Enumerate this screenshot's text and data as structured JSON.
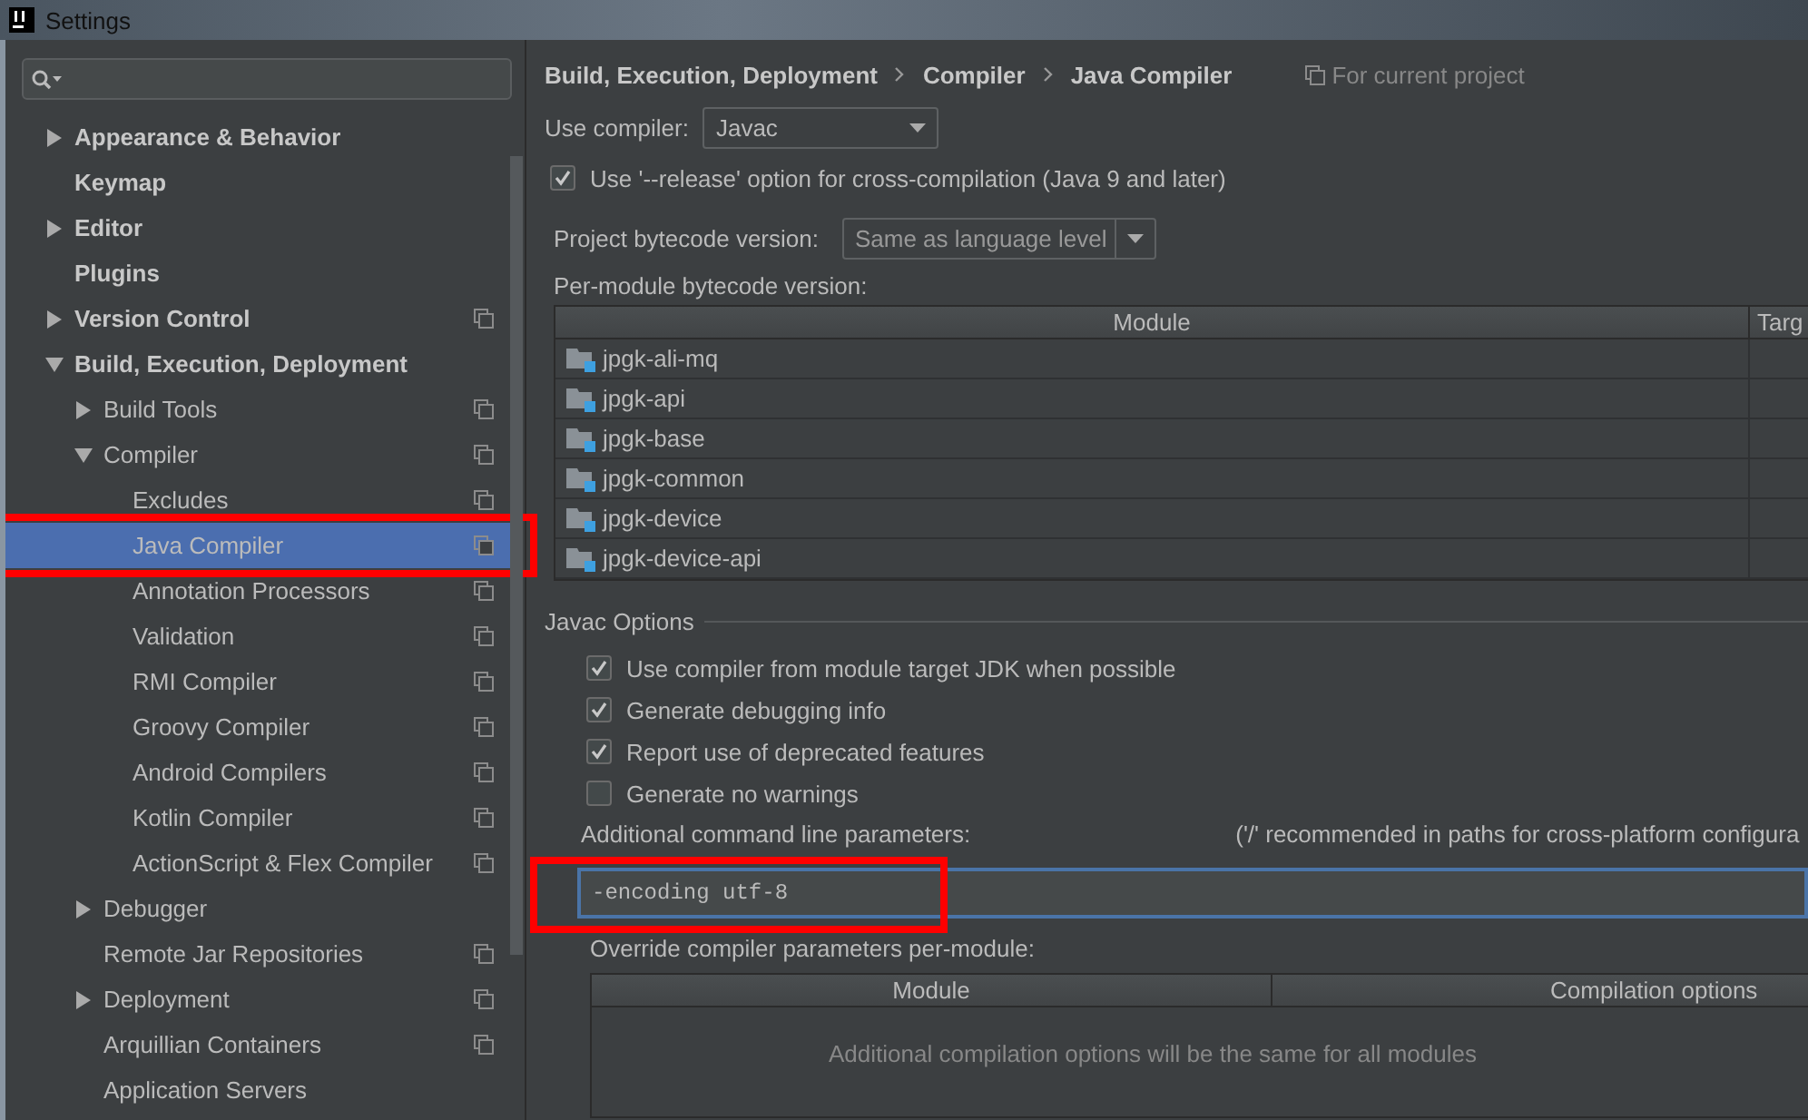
{
  "window": {
    "title": "Settings"
  },
  "sidebar": {
    "items": [
      {
        "label": "Appearance & Behavior",
        "expanded": false,
        "selected": false,
        "project_level": false
      },
      {
        "label": "Keymap",
        "selected": false,
        "project_level": false
      },
      {
        "label": "Editor",
        "expanded": false,
        "selected": false,
        "project_level": false
      },
      {
        "label": "Plugins",
        "selected": false,
        "project_level": false
      },
      {
        "label": "Version Control",
        "expanded": false,
        "selected": false,
        "project_level": true
      },
      {
        "label": "Build, Execution, Deployment",
        "expanded": true,
        "selected": false,
        "project_level": false,
        "children": [
          {
            "label": "Build Tools",
            "expanded": false,
            "selected": false,
            "project_level": true
          },
          {
            "label": "Compiler",
            "expanded": true,
            "selected": false,
            "project_level": true,
            "children": [
              {
                "label": "Excludes",
                "selected": false,
                "project_level": true
              },
              {
                "label": "Java Compiler",
                "selected": true,
                "project_level": true,
                "annotated": true
              },
              {
                "label": "Annotation Processors",
                "selected": false,
                "project_level": true
              },
              {
                "label": "Validation",
                "selected": false,
                "project_level": true
              },
              {
                "label": "RMI Compiler",
                "selected": false,
                "project_level": true
              },
              {
                "label": "Groovy Compiler",
                "selected": false,
                "project_level": true
              },
              {
                "label": "Android Compilers",
                "selected": false,
                "project_level": true
              },
              {
                "label": "Kotlin Compiler",
                "selected": false,
                "project_level": true
              },
              {
                "label": "ActionScript & Flex Compiler",
                "selected": false,
                "project_level": true
              }
            ]
          },
          {
            "label": "Debugger",
            "expanded": false,
            "selected": false,
            "project_level": false
          },
          {
            "label": "Remote Jar Repositories",
            "selected": false,
            "project_level": true
          },
          {
            "label": "Deployment",
            "expanded": false,
            "selected": false,
            "project_level": true
          },
          {
            "label": "Arquillian Containers",
            "selected": false,
            "project_level": true
          },
          {
            "label": "Application Servers",
            "selected": false,
            "project_level": false
          }
        ]
      }
    ]
  },
  "breadcrumb": [
    "Build, Execution, Deployment",
    "Compiler",
    "Java Compiler"
  ],
  "scope_note": "For current project",
  "use_compiler": {
    "label": "Use compiler:",
    "value": "Javac"
  },
  "release_option": {
    "label": "Use '--release' option for cross-compilation (Java 9 and later)",
    "checked": true
  },
  "project_bytecode": {
    "label": "Project bytecode version:",
    "value": "Same as language level"
  },
  "per_module": {
    "label": "Per-module bytecode version:",
    "columns": [
      "Module",
      "Targ"
    ],
    "rows": [
      "jpgk-ali-mq",
      "jpgk-api",
      "jpgk-base",
      "jpgk-common",
      "jpgk-device",
      "jpgk-device-api"
    ]
  },
  "javac_options": {
    "title": "Javac Options",
    "options": [
      {
        "label": "Use compiler from module target JDK when possible",
        "checked": true
      },
      {
        "label": "Generate debugging info",
        "checked": true
      },
      {
        "label": "Report use of deprecated features",
        "checked": true
      },
      {
        "label": "Generate no warnings",
        "checked": false
      }
    ],
    "params_label": "Additional command line parameters:",
    "params_hint": "('/' recommended in paths for cross-platform configura",
    "params_value": "-encoding utf-8",
    "params_annotated": true,
    "override_label": "Override compiler parameters per-module:",
    "override_columns": [
      "Module",
      "Compilation options"
    ],
    "override_empty": "Additional compilation options will be the same for all modules"
  }
}
